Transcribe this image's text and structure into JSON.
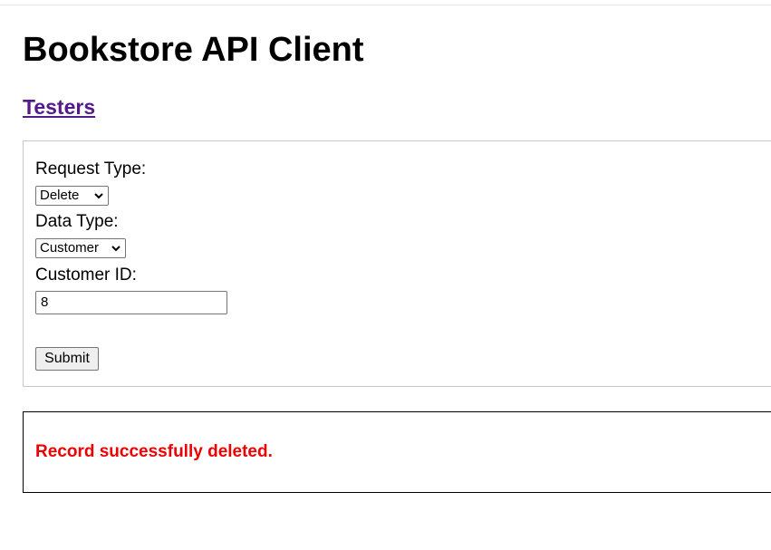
{
  "header": {
    "title": "Bookstore API Client",
    "testers_link": "Testers"
  },
  "form": {
    "request_type_label": "Request Type:",
    "request_type_value": "Delete",
    "data_type_label": "Data Type:",
    "data_type_value": "Customer",
    "customer_id_label": "Customer ID:",
    "customer_id_value": "8",
    "submit_label": "Submit"
  },
  "result": {
    "message": "Record successfully deleted.",
    "message_color": "#ee0000"
  },
  "colors": {
    "link": "#551a8b",
    "panel_border": "#c8c8c8",
    "result_border": "#000000"
  },
  "icons": {
    "select_arrow": "chevron-down-icon"
  }
}
